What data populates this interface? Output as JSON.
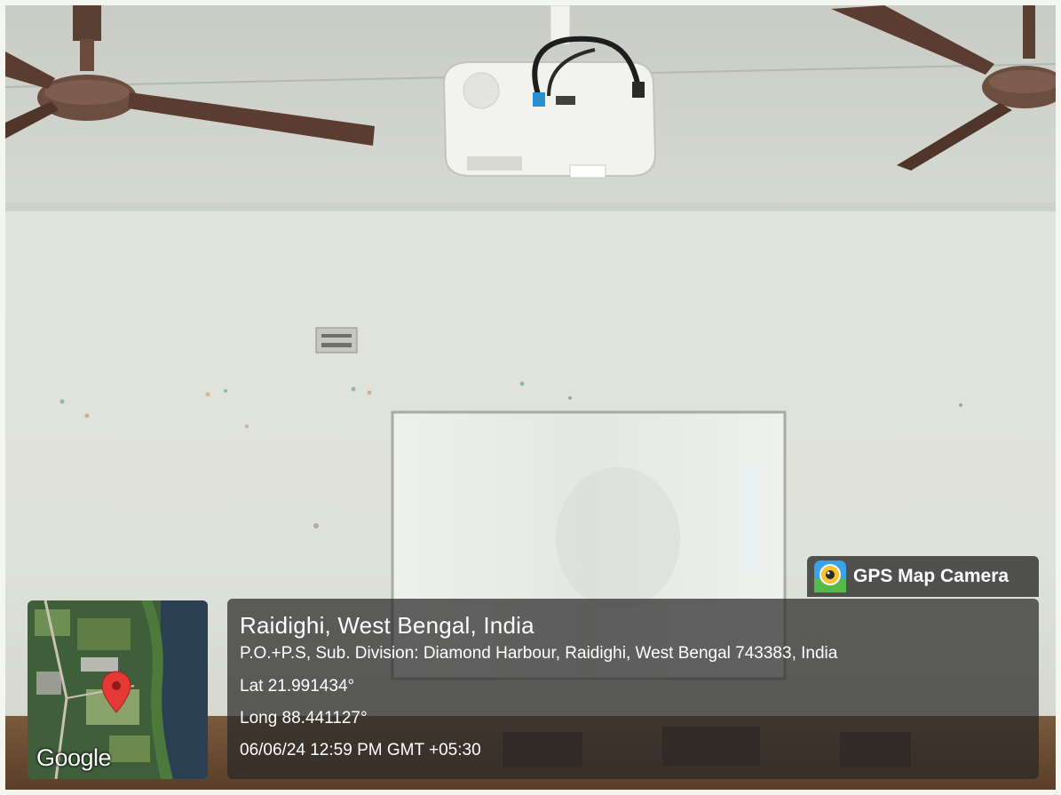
{
  "badge": {
    "label": "GPS Map Camera",
    "icon": "gps-map-camera-app-icon"
  },
  "location": {
    "place": "Raidighi, West Bengal, India",
    "address": "P.O.+P.S, Sub. Division: Diamond Harbour, Raidighi, West Bengal 743383, India",
    "latitude": "Lat 21.991434°",
    "longitude": "Long 88.441127°",
    "datetime": "06/06/24 12:59 PM GMT +05:30"
  },
  "map": {
    "provider_logo": "Google",
    "pin_icon": "map-pin-icon",
    "pin_color": "#e53935"
  },
  "colors": {
    "overlay": "#282828",
    "text": "#ffffff"
  }
}
